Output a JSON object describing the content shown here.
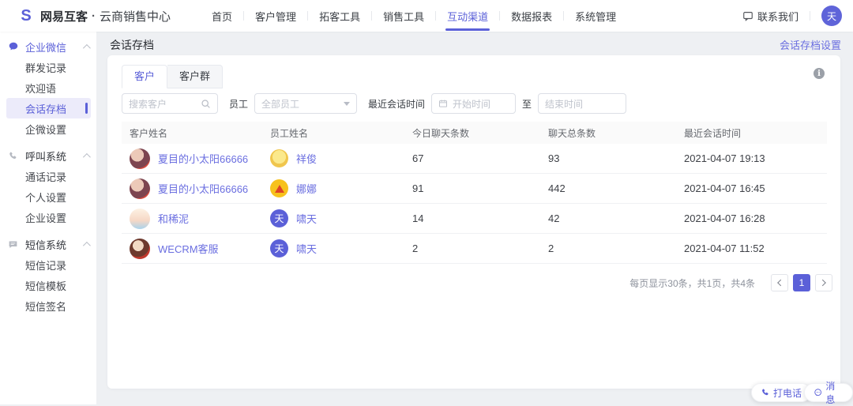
{
  "colors": {
    "accent": "#5b60d8",
    "link": "#6a6ee0",
    "active_bg": "#ecebfa"
  },
  "topnav": {
    "brand": {
      "name": "网易互客",
      "separator": "·",
      "sub": "云商销售中心"
    },
    "items": [
      {
        "label": "首页",
        "active": false
      },
      {
        "label": "客户管理",
        "active": false
      },
      {
        "label": "拓客工具",
        "active": false
      },
      {
        "label": "销售工具",
        "active": false
      },
      {
        "label": "互动渠道",
        "active": true
      },
      {
        "label": "数据报表",
        "active": false
      },
      {
        "label": "系统管理",
        "active": false
      }
    ],
    "contact_label": "联系我们",
    "avatar_text": "天"
  },
  "sidebar": {
    "sections": [
      {
        "label": "企业微信",
        "icon": "wechat-chat-icon",
        "children": [
          {
            "label": "群发记录"
          },
          {
            "label": "欢迎语"
          },
          {
            "label": "会话存档",
            "active": true
          },
          {
            "label": "企微设置"
          }
        ]
      },
      {
        "label": "呼叫系统",
        "icon": "phone-icon",
        "children": [
          {
            "label": "通话记录"
          },
          {
            "label": "个人设置"
          },
          {
            "label": "企业设置"
          }
        ]
      },
      {
        "label": "短信系统",
        "icon": "sms-icon",
        "children": [
          {
            "label": "短信记录"
          },
          {
            "label": "短信模板"
          },
          {
            "label": "短信签名"
          }
        ]
      }
    ]
  },
  "page": {
    "title": "会话存档",
    "settings_link": "会话存档设置",
    "tabs": [
      {
        "label": "客户",
        "active": true
      },
      {
        "label": "客户群",
        "active": false
      }
    ],
    "filters": {
      "search_placeholder": "搜索客户",
      "employee_label": "员工",
      "employee_value": "全部员工",
      "time_label": "最近会话时间",
      "start_placeholder": "开始时间",
      "to_label": "至",
      "end_placeholder": "结束时间"
    },
    "table": {
      "columns": [
        "客户姓名",
        "员工姓名",
        "今日聊天条数",
        "聊天总条数",
        "最近会话时间"
      ],
      "rows": [
        {
          "customer": "夏目的小太阳66666",
          "customer_avatar": "girl",
          "employee": "祥俊",
          "employee_avatar": "doge",
          "employee_avatar_text": "",
          "today": "67",
          "total": "93",
          "last_time": "2021-04-07 19:13"
        },
        {
          "customer": "夏目的小太阳66666",
          "customer_avatar": "girl",
          "employee": "娜娜",
          "employee_avatar": "nana",
          "employee_avatar_text": "",
          "today": "91",
          "total": "442",
          "last_time": "2021-04-07 16:45"
        },
        {
          "customer": "和稀泥",
          "customer_avatar": "baby",
          "employee": "啸天",
          "employee_avatar": "tian",
          "employee_avatar_text": "天",
          "today": "14",
          "total": "42",
          "last_time": "2021-04-07 16:28"
        },
        {
          "customer": "WECRM客服",
          "customer_avatar": "anime",
          "employee": "啸天",
          "employee_avatar": "tian",
          "employee_avatar_text": "天",
          "today": "2",
          "total": "2",
          "last_time": "2021-04-07 11:52"
        }
      ]
    },
    "pagination": {
      "summary": "每页显示30条，共1页，共4条",
      "current_page": "1"
    }
  },
  "floating": {
    "call_label": "打电话",
    "message_label": "消息"
  }
}
